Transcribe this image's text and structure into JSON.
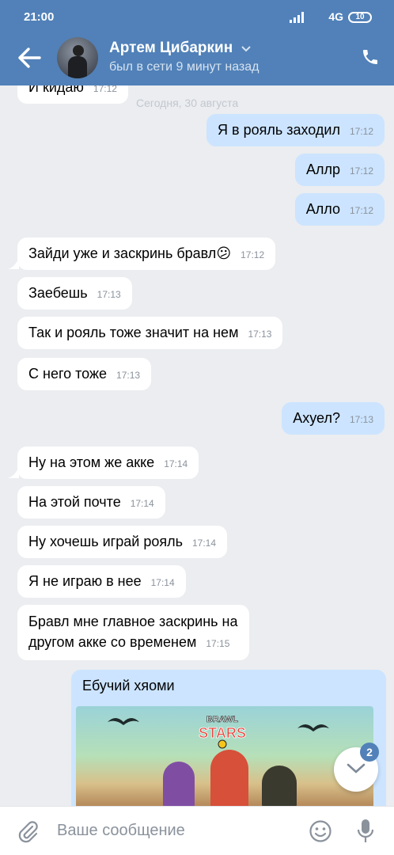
{
  "status_bar": {
    "time": "21:00",
    "network": "4G",
    "battery": "10"
  },
  "header": {
    "name": "Артем Цибаркин",
    "presence": "был в сети 9 минут назад"
  },
  "date_separator": "Сегодня, 30 августа",
  "messages": [
    {
      "dir": "in",
      "text": "И кидаю",
      "time": "17:12"
    },
    {
      "dir": "out",
      "text": "Я в рояль заходил",
      "time": "17:12"
    },
    {
      "dir": "out",
      "text": "Аллр",
      "time": "17:12"
    },
    {
      "dir": "out",
      "text": "Алло",
      "time": "17:12"
    },
    {
      "dir": "in",
      "text": "Зайди уже и заскринь бравл",
      "emoji": "😕",
      "time": "17:12"
    },
    {
      "dir": "in",
      "text": "Заебешь",
      "time": "17:13"
    },
    {
      "dir": "in",
      "text": "Так и рояль тоже значит на нем",
      "time": "17:13"
    },
    {
      "dir": "in",
      "text": "С него тоже",
      "time": "17:13"
    },
    {
      "dir": "out",
      "text": "Ахуел?",
      "time": "17:13"
    },
    {
      "dir": "in",
      "text": "Ну на этом же акке",
      "time": "17:14"
    },
    {
      "dir": "in",
      "text": "На этой почте",
      "time": "17:14"
    },
    {
      "dir": "in",
      "text": "Ну хочешь играй рояль",
      "time": "17:14"
    },
    {
      "dir": "in",
      "text": "Я не играю в нее",
      "time": "17:14"
    },
    {
      "dir": "in",
      "text_line1": "Бравл мне главное заскринь на",
      "text_line2": "другом акке со временем",
      "time": "17:15"
    }
  ],
  "photo_message": {
    "caption": "Ебучий хяоми",
    "image_logo_line1": "BRAWL",
    "image_logo_line2": "STARS"
  },
  "scroll_badge": "2",
  "composer": {
    "placeholder": "Ваше сообщение"
  },
  "colors": {
    "header": "#5181b8",
    "outgoing": "#cce4ff",
    "incoming": "#ffffff",
    "background": "#ebedf0"
  }
}
